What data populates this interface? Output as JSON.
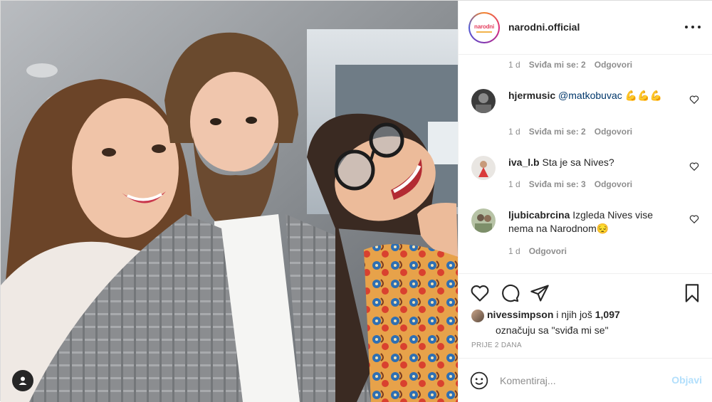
{
  "post": {
    "username": "narodni.official",
    "logo_text": "narodni"
  },
  "comments": [
    {
      "username": "",
      "text": "",
      "age": "1 d",
      "likes_label": "Sviđa mi se: 2",
      "reply_label": "Odgovori"
    },
    {
      "username": "hjermusic",
      "mention": "@matkobuvac",
      "text": " 💪💪💪",
      "age": "1 d",
      "likes_label": "Sviđa mi se: 2",
      "reply_label": "Odgovori"
    },
    {
      "username": "iva_l.b",
      "text": "Sta je sa Nives?",
      "age": "1 d",
      "likes_label": "Sviđa mi se: 3",
      "reply_label": "Odgovori"
    },
    {
      "username": "ljubicabrcina",
      "text": "Izgleda Nives vise nema na Narodnom😔",
      "age": "1 d",
      "likes_label": "",
      "reply_label": "Odgovori"
    }
  ],
  "likes": {
    "liker": "nivessimpson",
    "connector": " i njih još ",
    "count": "1,097",
    "line2": "označuju sa \"sviđa mi se\""
  },
  "date_label": "PRIJE 2 DANA",
  "comment_box": {
    "placeholder": "Komentiraj...",
    "post_label": "Objavi"
  },
  "icons": {
    "more": "more-options-icon",
    "like": "heart-icon",
    "comment": "comment-icon",
    "share": "share-icon",
    "save": "bookmark-icon",
    "emoji": "emoji-icon",
    "tag": "user-tag-icon"
  },
  "colors": {
    "text": "#262626",
    "muted": "#8e8e8e",
    "mention": "#00376b",
    "post_disabled": "#b2dffc",
    "border": "#efefef"
  }
}
